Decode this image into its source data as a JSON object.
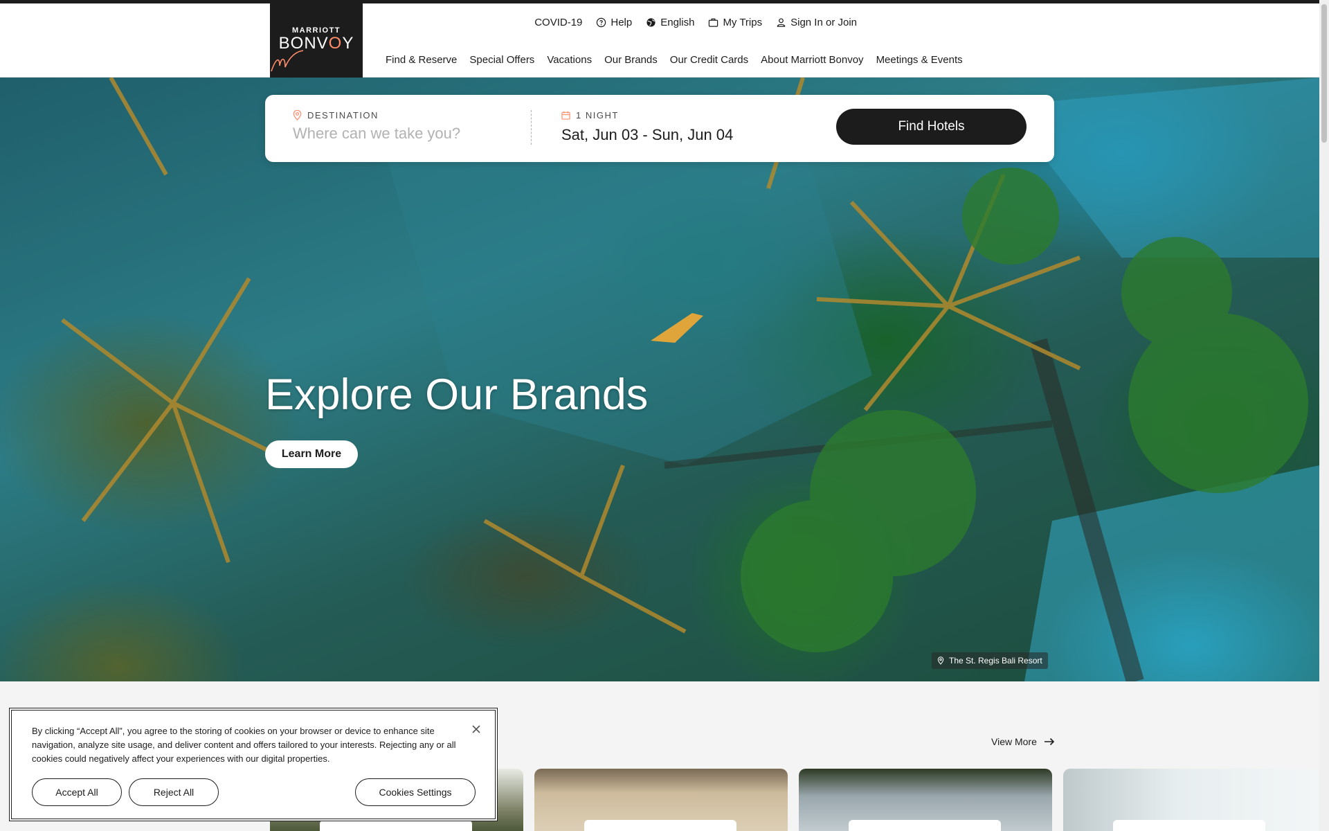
{
  "brand": {
    "logo_top": "MARRIOTT",
    "logo_main_a": "BONV",
    "logo_main_b": "O",
    "logo_main_c": "Y",
    "accent_color": "#ff8d6b"
  },
  "utility_nav": [
    {
      "label": "COVID-19",
      "icon": ""
    },
    {
      "label": "Help",
      "icon": "help-circle-icon"
    },
    {
      "label": "English",
      "icon": "globe-icon"
    },
    {
      "label": "My Trips",
      "icon": "suitcase-icon"
    },
    {
      "label": "Sign In or Join",
      "icon": "user-icon"
    }
  ],
  "main_nav": [
    {
      "label": "Find & Reserve"
    },
    {
      "label": "Special Offers"
    },
    {
      "label": "Vacations"
    },
    {
      "label": "Our Brands"
    },
    {
      "label": "Our Credit Cards"
    },
    {
      "label": "About Marriott Bonvoy"
    },
    {
      "label": "Meetings & Events"
    }
  ],
  "search": {
    "destination_label": "DESTINATION",
    "destination_placeholder": "Where can we take you?",
    "destination_value": "",
    "nights_label": "1 NIGHT",
    "dates_value": "Sat, Jun 03 - Sun, Jun 04",
    "submit_label": "Find Hotels"
  },
  "hero": {
    "title": "Explore Our Brands",
    "cta_label": "Learn More",
    "location_tag": "The St. Regis Bali Resort"
  },
  "section": {
    "view_more_label": "View More"
  },
  "cookie_banner": {
    "text": "By clicking “Accept All”, you agree to the storing of cookies on your browser or device to enhance site navigation, analyze site usage, and deliver content and offers tailored to your interests. Rejecting any or all cookies could negatively affect your experiences with our digital properties.",
    "accept_label": "Accept All",
    "reject_label": "Reject All",
    "settings_label": "Cookies Settings"
  }
}
